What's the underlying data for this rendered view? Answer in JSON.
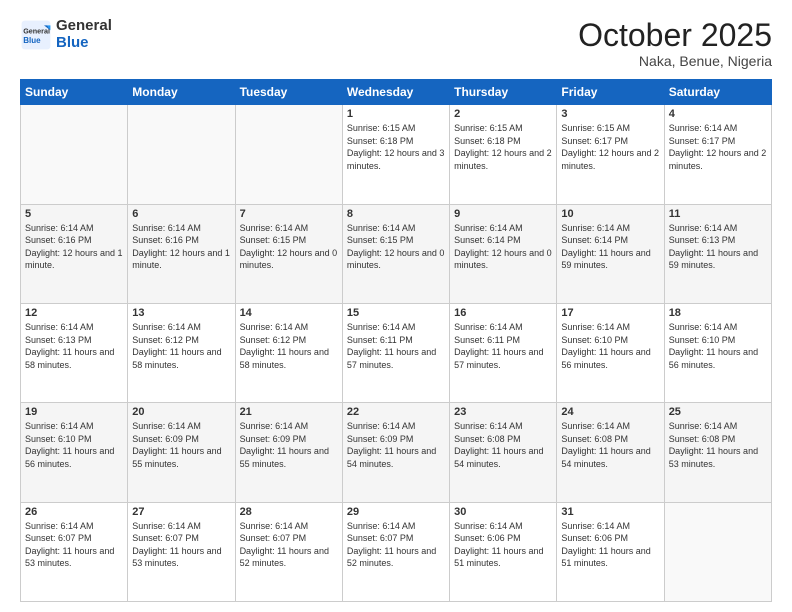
{
  "logo": {
    "line1": "General",
    "line2": "Blue"
  },
  "title": "October 2025",
  "subtitle": "Naka, Benue, Nigeria",
  "days_of_week": [
    "Sunday",
    "Monday",
    "Tuesday",
    "Wednesday",
    "Thursday",
    "Friday",
    "Saturday"
  ],
  "weeks": [
    [
      {
        "day": "",
        "info": ""
      },
      {
        "day": "",
        "info": ""
      },
      {
        "day": "",
        "info": ""
      },
      {
        "day": "1",
        "info": "Sunrise: 6:15 AM\nSunset: 6:18 PM\nDaylight: 12 hours and 3 minutes."
      },
      {
        "day": "2",
        "info": "Sunrise: 6:15 AM\nSunset: 6:18 PM\nDaylight: 12 hours and 2 minutes."
      },
      {
        "day": "3",
        "info": "Sunrise: 6:15 AM\nSunset: 6:17 PM\nDaylight: 12 hours and 2 minutes."
      },
      {
        "day": "4",
        "info": "Sunrise: 6:14 AM\nSunset: 6:17 PM\nDaylight: 12 hours and 2 minutes."
      }
    ],
    [
      {
        "day": "5",
        "info": "Sunrise: 6:14 AM\nSunset: 6:16 PM\nDaylight: 12 hours and 1 minute."
      },
      {
        "day": "6",
        "info": "Sunrise: 6:14 AM\nSunset: 6:16 PM\nDaylight: 12 hours and 1 minute."
      },
      {
        "day": "7",
        "info": "Sunrise: 6:14 AM\nSunset: 6:15 PM\nDaylight: 12 hours and 0 minutes."
      },
      {
        "day": "8",
        "info": "Sunrise: 6:14 AM\nSunset: 6:15 PM\nDaylight: 12 hours and 0 minutes."
      },
      {
        "day": "9",
        "info": "Sunrise: 6:14 AM\nSunset: 6:14 PM\nDaylight: 12 hours and 0 minutes."
      },
      {
        "day": "10",
        "info": "Sunrise: 6:14 AM\nSunset: 6:14 PM\nDaylight: 11 hours and 59 minutes."
      },
      {
        "day": "11",
        "info": "Sunrise: 6:14 AM\nSunset: 6:13 PM\nDaylight: 11 hours and 59 minutes."
      }
    ],
    [
      {
        "day": "12",
        "info": "Sunrise: 6:14 AM\nSunset: 6:13 PM\nDaylight: 11 hours and 58 minutes."
      },
      {
        "day": "13",
        "info": "Sunrise: 6:14 AM\nSunset: 6:12 PM\nDaylight: 11 hours and 58 minutes."
      },
      {
        "day": "14",
        "info": "Sunrise: 6:14 AM\nSunset: 6:12 PM\nDaylight: 11 hours and 58 minutes."
      },
      {
        "day": "15",
        "info": "Sunrise: 6:14 AM\nSunset: 6:11 PM\nDaylight: 11 hours and 57 minutes."
      },
      {
        "day": "16",
        "info": "Sunrise: 6:14 AM\nSunset: 6:11 PM\nDaylight: 11 hours and 57 minutes."
      },
      {
        "day": "17",
        "info": "Sunrise: 6:14 AM\nSunset: 6:10 PM\nDaylight: 11 hours and 56 minutes."
      },
      {
        "day": "18",
        "info": "Sunrise: 6:14 AM\nSunset: 6:10 PM\nDaylight: 11 hours and 56 minutes."
      }
    ],
    [
      {
        "day": "19",
        "info": "Sunrise: 6:14 AM\nSunset: 6:10 PM\nDaylight: 11 hours and 56 minutes."
      },
      {
        "day": "20",
        "info": "Sunrise: 6:14 AM\nSunset: 6:09 PM\nDaylight: 11 hours and 55 minutes."
      },
      {
        "day": "21",
        "info": "Sunrise: 6:14 AM\nSunset: 6:09 PM\nDaylight: 11 hours and 55 minutes."
      },
      {
        "day": "22",
        "info": "Sunrise: 6:14 AM\nSunset: 6:09 PM\nDaylight: 11 hours and 54 minutes."
      },
      {
        "day": "23",
        "info": "Sunrise: 6:14 AM\nSunset: 6:08 PM\nDaylight: 11 hours and 54 minutes."
      },
      {
        "day": "24",
        "info": "Sunrise: 6:14 AM\nSunset: 6:08 PM\nDaylight: 11 hours and 54 minutes."
      },
      {
        "day": "25",
        "info": "Sunrise: 6:14 AM\nSunset: 6:08 PM\nDaylight: 11 hours and 53 minutes."
      }
    ],
    [
      {
        "day": "26",
        "info": "Sunrise: 6:14 AM\nSunset: 6:07 PM\nDaylight: 11 hours and 53 minutes."
      },
      {
        "day": "27",
        "info": "Sunrise: 6:14 AM\nSunset: 6:07 PM\nDaylight: 11 hours and 53 minutes."
      },
      {
        "day": "28",
        "info": "Sunrise: 6:14 AM\nSunset: 6:07 PM\nDaylight: 11 hours and 52 minutes."
      },
      {
        "day": "29",
        "info": "Sunrise: 6:14 AM\nSunset: 6:07 PM\nDaylight: 11 hours and 52 minutes."
      },
      {
        "day": "30",
        "info": "Sunrise: 6:14 AM\nSunset: 6:06 PM\nDaylight: 11 hours and 51 minutes."
      },
      {
        "day": "31",
        "info": "Sunrise: 6:14 AM\nSunset: 6:06 PM\nDaylight: 11 hours and 51 minutes."
      },
      {
        "day": "",
        "info": ""
      }
    ]
  ]
}
